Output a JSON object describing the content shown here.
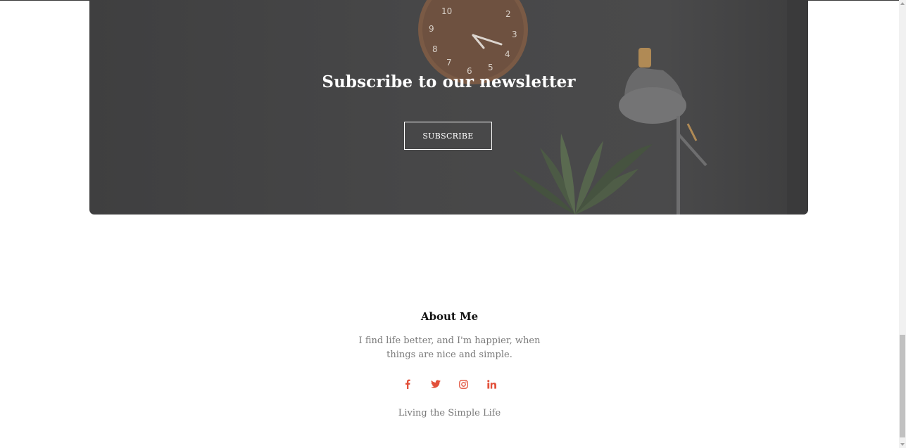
{
  "newsletter": {
    "title": "Subscribe to our newsletter",
    "subscribe_label": "SUBSCRIBE"
  },
  "about": {
    "title": "About Me",
    "text": "I find life better, and I'm happier, when things are nice and simple.",
    "social_icons": [
      "facebook-icon",
      "twitter-icon",
      "instagram-icon",
      "linkedin-icon"
    ],
    "tagline": "Living the Simple Life"
  },
  "clock_numbers": [
    "10",
    "2",
    "9",
    "3",
    "8",
    "4",
    "7",
    "6",
    "5"
  ],
  "colors": {
    "accent": "#e2503a",
    "newsletter_bg": "#444445",
    "muted_text": "#7a7a7a"
  }
}
